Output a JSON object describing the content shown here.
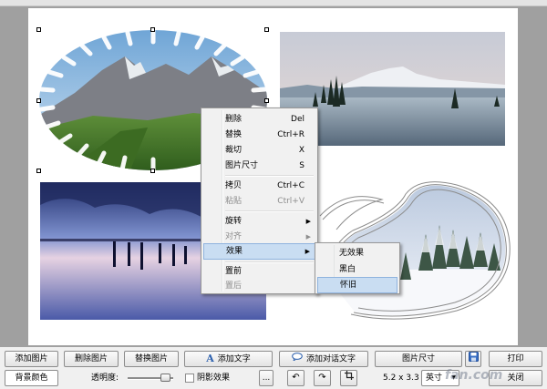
{
  "context_menu": {
    "items": [
      {
        "label": "删除",
        "shortcut": "Del",
        "enabled": true
      },
      {
        "label": "替换",
        "shortcut": "Ctrl+R",
        "enabled": true
      },
      {
        "label": "裁切",
        "shortcut": "X",
        "enabled": true
      },
      {
        "label": "图片尺寸",
        "shortcut": "S",
        "enabled": true
      },
      {
        "label": "拷贝",
        "shortcut": "Ctrl+C",
        "enabled": true
      },
      {
        "label": "粘贴",
        "shortcut": "Ctrl+V",
        "enabled": false
      },
      {
        "label": "旋转",
        "enabled": true
      },
      {
        "label": "对齐",
        "enabled": false
      },
      {
        "label": "效果",
        "enabled": true,
        "highlighted": true
      },
      {
        "label": "置前",
        "enabled": true
      },
      {
        "label": "置后",
        "enabled": false
      }
    ]
  },
  "effects_submenu": {
    "items": [
      {
        "label": "无效果"
      },
      {
        "label": "黑白"
      },
      {
        "label": "怀旧",
        "highlighted": true
      }
    ]
  },
  "toolbar_row1": {
    "add_image": "添加图片",
    "delete_image": "删除图片",
    "replace_image": "替换图片",
    "add_text": "添加文字",
    "add_bubble_text": "添加对话文字",
    "image_size": "图片尺寸",
    "print": "打印"
  },
  "toolbar_row2": {
    "bg_color": "背景颜色",
    "opacity_label": "透明度:",
    "opacity_value": 0.8,
    "shadow_label": "阴影效果",
    "shadow_checked": false,
    "more": "...",
    "size_readout": "5.2 x 3.3",
    "unit_select": "英寸",
    "close": "关闭"
  },
  "watermark": "fan.com",
  "colors": {
    "accent": "#2b5fad",
    "menu_highlight": "#c9ddf2",
    "workspace_bg": "#a0a0a0"
  }
}
